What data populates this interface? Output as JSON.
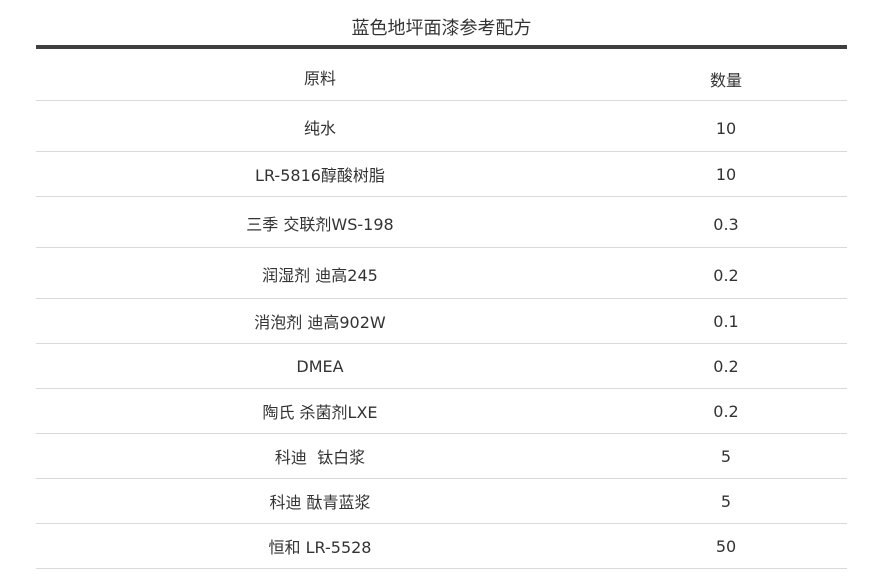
{
  "title": "蓝色地坪面漆参考配方",
  "table": {
    "headers": [
      "原料",
      "数量"
    ],
    "rows": [
      {
        "name": "纯水",
        "qty": "10"
      },
      {
        "name": "LR-5816醇酸树脂",
        "qty": "10"
      },
      {
        "name": "三季 交联剂WS-198",
        "qty": "0.3"
      },
      {
        "name": "润湿剂 迪高245",
        "qty": "0.2"
      },
      {
        "name": "消泡剂 迪高902W",
        "qty": "0.1"
      },
      {
        "name": "DMEA",
        "qty": "0.2"
      },
      {
        "name": "陶氏 杀菌剂LXE",
        "qty": "0.2"
      },
      {
        "name": "科迪  钛白浆",
        "qty": "5"
      },
      {
        "name": "科迪 酞青蓝浆",
        "qty": "5"
      },
      {
        "name": "恒和 LR-5528",
        "qty": "50"
      }
    ]
  }
}
